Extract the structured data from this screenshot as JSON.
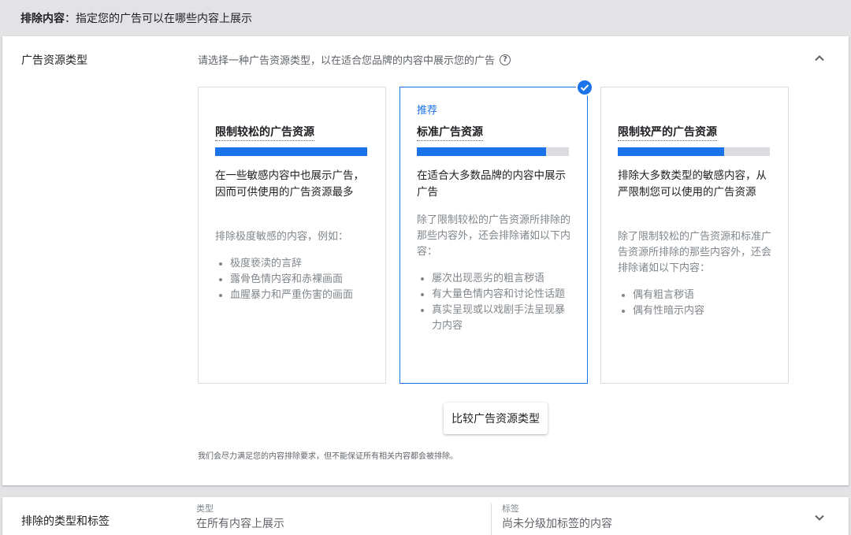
{
  "header": {
    "title_bold": "排除内容",
    "title_rest": "：指定您的广告可以在哪些内容上展示"
  },
  "inventory": {
    "section_title": "广告资源类型",
    "description": "请选择一种广告资源类型，以在适合您品牌的内容中展示您的广告",
    "help_icon": "?",
    "cards": [
      {
        "recommended": "",
        "title": "限制较松的广告资源",
        "level": 1.0,
        "lead": "在一些敏感内容中也展示广告，因而可供使用的广告资源最多",
        "sub": "排除极度敏感的内容，例如：",
        "bullets": [
          "极度亵渎的言辞",
          "露骨色情内容和赤裸画面",
          "血腥暴力和严重伤害的画面"
        ]
      },
      {
        "recommended": "推荐",
        "title": "标准广告资源",
        "level": 0.85,
        "lead": "在适合大多数品牌的内容中展示广告",
        "sub": "除了限制较松的广告资源所排除的那些内容外，还会排除诸如以下内容：",
        "bullets": [
          "屡次出现恶劣的粗言秽语",
          "有大量色情内容和讨论性话题",
          "真实呈现或以戏剧手法呈现暴力内容"
        ]
      },
      {
        "recommended": "",
        "title": "限制较严的广告资源",
        "level": 0.7,
        "lead": "排除大多数类型的敏感内容，从严限制您可以使用的广告资源",
        "sub": "除了限制较松的广告资源和标准广告资源所排除的那些内容外，还会排除诸如以下内容：",
        "bullets": [
          "偶有粗言秽语",
          "偶有性暗示内容"
        ]
      }
    ],
    "selected_index": 1,
    "compare_button": "比较广告资源类型",
    "footnote": "我们会尽力满足您的内容排除要求，但不能保证所有相关内容都会被排除。"
  },
  "exclusions": {
    "section_title": "排除的类型和标签",
    "type_label": "类型",
    "type_value": "在所有内容上展示",
    "tag_label": "标签",
    "tag_value": "尚未分级加标签的内容"
  },
  "colors": {
    "accent": "#1a73e8",
    "bar_track": "#dadce0",
    "background": "#e3e3e5"
  },
  "icons": {
    "collapse": "chevron-up-icon",
    "expand": "chevron-down-icon",
    "selected": "check-circle-icon",
    "help": "help-icon"
  }
}
